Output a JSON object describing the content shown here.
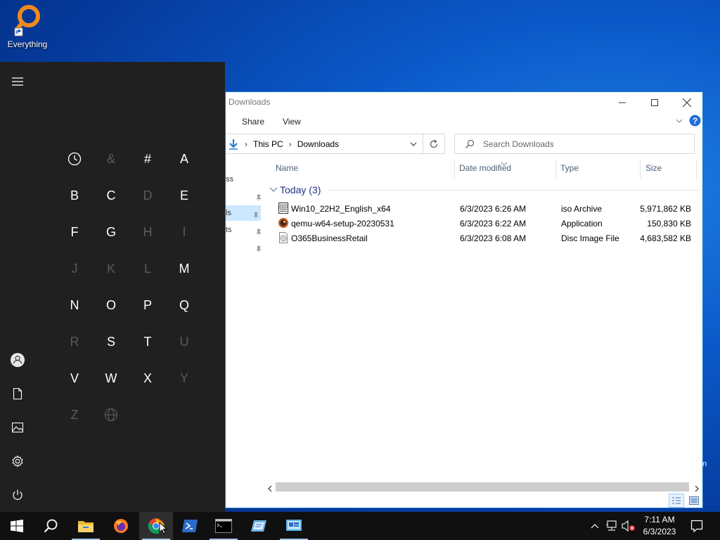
{
  "desktop": {
    "icon_label": "Everything"
  },
  "explorer": {
    "title": "Downloads",
    "ribbon_tabs": [
      "Share",
      "View"
    ],
    "breadcrumb": [
      "This PC",
      "Downloads"
    ],
    "search_placeholder": "Search Downloads",
    "nav_fragments": [
      "ss",
      "ls",
      "ts"
    ],
    "columns": [
      "Name",
      "Date modified",
      "Type",
      "Size"
    ],
    "group_label": "Today (3)",
    "files": [
      {
        "name": "Win10_22H2_English_x64",
        "date": "6/3/2023 6:26 AM",
        "type": "iso Archive",
        "size": "5,971,862 KB",
        "icon": "iso-archive-icon"
      },
      {
        "name": "qemu-w64-setup-20230531",
        "date": "6/3/2023 6:22 AM",
        "type": "Application",
        "size": "150,830 KB",
        "icon": "qemu-app-icon"
      },
      {
        "name": "O365BusinessRetail",
        "date": "6/3/2023 6:08 AM",
        "type": "Disc Image File",
        "size": "4,683,582 KB",
        "icon": "disc-image-icon"
      }
    ]
  },
  "start_menu": {
    "letters": [
      {
        "t": "clock",
        "on": true
      },
      {
        "t": "&",
        "on": false
      },
      {
        "t": "#",
        "on": true
      },
      {
        "t": "A",
        "on": true
      },
      {
        "t": "B",
        "on": true
      },
      {
        "t": "C",
        "on": true
      },
      {
        "t": "D",
        "on": false
      },
      {
        "t": "E",
        "on": true
      },
      {
        "t": "F",
        "on": true
      },
      {
        "t": "G",
        "on": true
      },
      {
        "t": "H",
        "on": false
      },
      {
        "t": "I",
        "on": false
      },
      {
        "t": "J",
        "on": false
      },
      {
        "t": "K",
        "on": false
      },
      {
        "t": "L",
        "on": false
      },
      {
        "t": "M",
        "on": true
      },
      {
        "t": "N",
        "on": true
      },
      {
        "t": "O",
        "on": true
      },
      {
        "t": "P",
        "on": true
      },
      {
        "t": "Q",
        "on": true
      },
      {
        "t": "R",
        "on": false
      },
      {
        "t": "S",
        "on": true
      },
      {
        "t": "T",
        "on": true
      },
      {
        "t": "U",
        "on": false
      },
      {
        "t": "V",
        "on": true
      },
      {
        "t": "W",
        "on": true
      },
      {
        "t": "X",
        "on": true
      },
      {
        "t": "Y",
        "on": false
      },
      {
        "t": "Z",
        "on": false
      },
      {
        "t": "globe",
        "on": false
      }
    ],
    "rail_icons": [
      "hamburger-icon",
      "user-icon",
      "documents-icon",
      "pictures-icon",
      "settings-icon",
      "power-icon"
    ]
  },
  "taskbar": {
    "apps": [
      "start-icon",
      "search-icon",
      "file-explorer-icon",
      "firefox-icon",
      "chrome-icon",
      "powershell-icon",
      "command-prompt-icon",
      "notepad-icon",
      "remote-desktop-icon"
    ],
    "active_app": "chrome-icon",
    "time": "7:11 AM",
    "date": "6/3/2023"
  }
}
